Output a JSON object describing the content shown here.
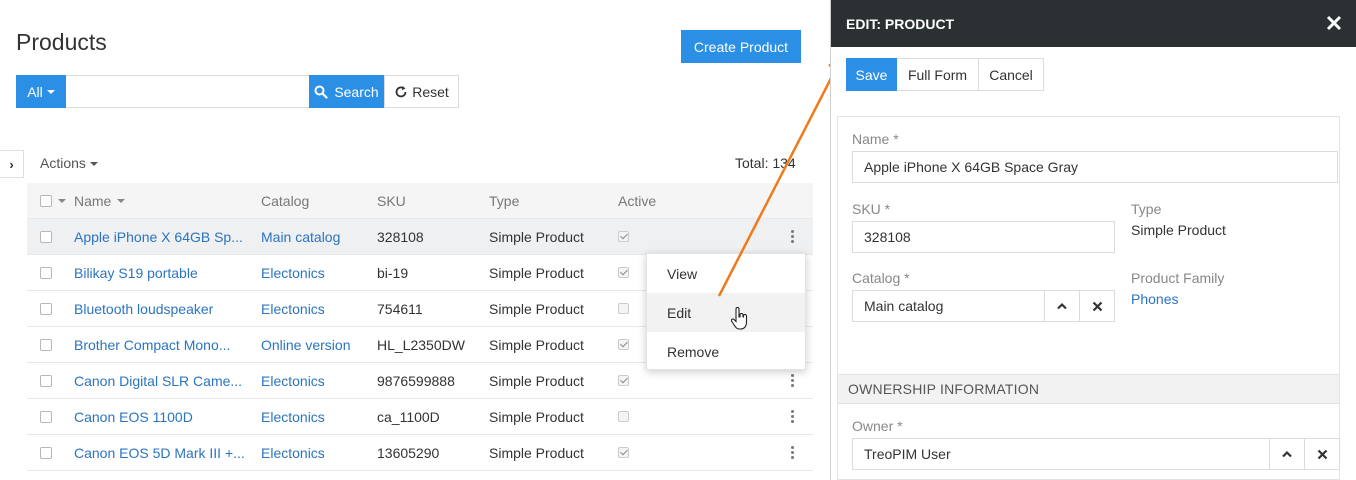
{
  "page": {
    "title": "Products",
    "create_label": "Create Product"
  },
  "search": {
    "filter_label": "All",
    "value": "",
    "placeholder": "",
    "search_label": "Search",
    "reset_label": "Reset"
  },
  "list": {
    "actions_label": "Actions",
    "total_label": "Total: 134",
    "columns": [
      "Name",
      "Catalog",
      "SKU",
      "Type",
      "Active"
    ],
    "rows": [
      {
        "name": "Apple iPhone X 64GB Sp...",
        "catalog": "Main catalog",
        "sku": "328108",
        "type": "Simple Product",
        "active": true
      },
      {
        "name": "Bilikay S19 portable",
        "catalog": "Electonics",
        "sku": "bi-19",
        "type": "Simple Product",
        "active": true
      },
      {
        "name": "Bluetooth loudspeaker",
        "catalog": "Electonics",
        "sku": "754611",
        "type": "Simple Product",
        "active": false
      },
      {
        "name": "Brother Compact Mono...",
        "catalog": "Online version",
        "sku": "HL_L2350DW",
        "type": "Simple Product",
        "active": true
      },
      {
        "name": "Canon Digital SLR Came...",
        "catalog": "Electonics",
        "sku": "9876599888",
        "type": "Simple Product",
        "active": true
      },
      {
        "name": "Canon EOS 1100D",
        "catalog": "Electonics",
        "sku": "ca_1100D",
        "type": "Simple Product",
        "active": false
      },
      {
        "name": "Canon EOS 5D Mark III +...",
        "catalog": "Electonics",
        "sku": "13605290",
        "type": "Simple Product",
        "active": true
      }
    ]
  },
  "row_menu": {
    "items": [
      "View",
      "Edit",
      "Remove"
    ]
  },
  "panel": {
    "title": "EDIT: PRODUCT",
    "save_label": "Save",
    "full_form_label": "Full Form",
    "cancel_label": "Cancel",
    "name_label": "Name *",
    "name_value": "Apple iPhone X 64GB Space Gray",
    "sku_label": "SKU *",
    "sku_value": "328108",
    "type_label": "Type",
    "type_value": "Simple Product",
    "catalog_label": "Catalog *",
    "catalog_value": "Main catalog",
    "family_label": "Product Family",
    "family_value": "Phones",
    "ownership_title": "OWNERSHIP INFORMATION",
    "owner_label": "Owner *",
    "owner_value": "TreoPIM User"
  },
  "colors": {
    "primary": "#2b8fe5",
    "link": "#2b74c1",
    "header_dark": "#2b3033",
    "annotation": "#f07a1a"
  },
  "icons": [
    "search-icon",
    "reset-icon",
    "close-icon",
    "chevron-up-icon",
    "x-icon",
    "kebab-icon",
    "hand-cursor-icon",
    "chevron-right-icon"
  ]
}
